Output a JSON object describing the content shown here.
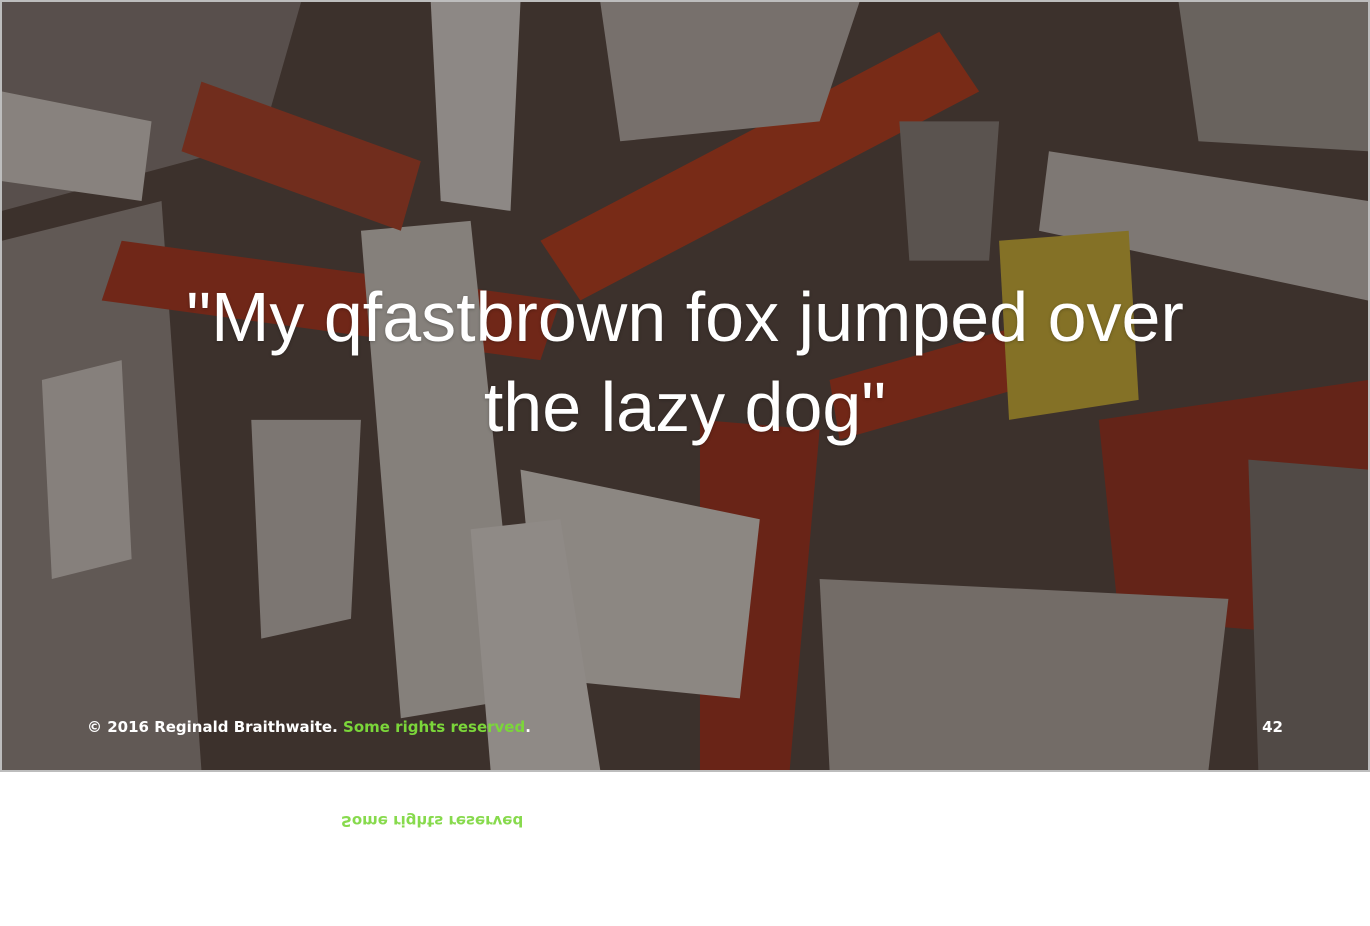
{
  "slide": {
    "quote_line1": "\"My qfastbrown fox jumped over",
    "quote_line2": "the lazy dog\"",
    "footer": {
      "copyright": "© 2016 Reginald Braithwaite. ",
      "link_text": "Some rights reserved",
      "period": ".",
      "page_number": "42"
    }
  },
  "colors": {
    "link": "#7bd63a",
    "text": "#ffffff"
  },
  "background": {
    "image": "shredded-paper-photo"
  }
}
